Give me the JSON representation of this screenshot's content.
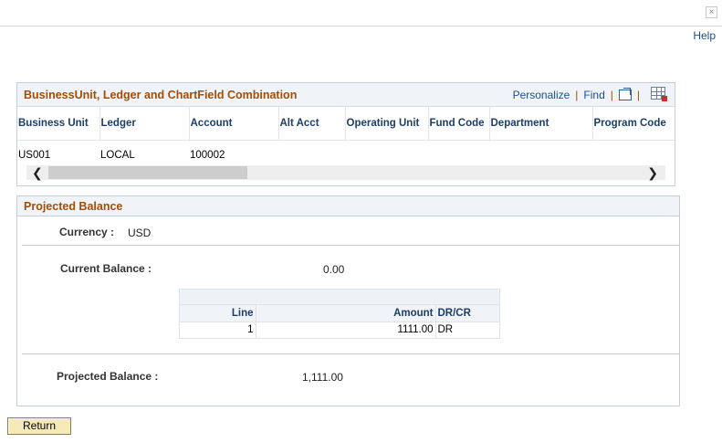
{
  "window": {
    "close_glyph": "×",
    "help_label": "Help"
  },
  "grid": {
    "title": "BusinessUnit, Ledger and ChartField Combination",
    "personalize_label": "Personalize",
    "find_label": "Find",
    "separator": "|",
    "columns": [
      "Business Unit",
      "Ledger",
      "Account",
      "Alt Acct",
      "Operating Unit",
      "Fund Code",
      "Department",
      "Program Code"
    ],
    "rows": [
      [
        "US001",
        "LOCAL",
        "100002",
        "",
        "",
        "",
        "",
        ""
      ]
    ],
    "scroll_left_glyph": "❮",
    "scroll_right_glyph": "❯"
  },
  "projected": {
    "title": "Projected Balance",
    "currency_label": "Currency :",
    "currency_value": "USD",
    "current_balance_label": "Current Balance :",
    "current_balance_value": "0.00",
    "lines": {
      "columns": [
        "Line",
        "Amount",
        "DR/CR"
      ],
      "rows": [
        [
          "1",
          "1111.00",
          "DR"
        ]
      ]
    },
    "projected_balance_label": "Projected Balance :",
    "projected_balance_value": "1,111.00"
  },
  "footer": {
    "return_label": "Return"
  },
  "colors": {
    "section_title": "#a04e0a",
    "link": "#1a4f8f",
    "header_text": "#1d3e66",
    "return_button_bg": "#f6e9b8"
  },
  "icons": {
    "close": "close-icon",
    "view_all": "new-window-icon",
    "download": "spreadsheet-download-icon"
  }
}
